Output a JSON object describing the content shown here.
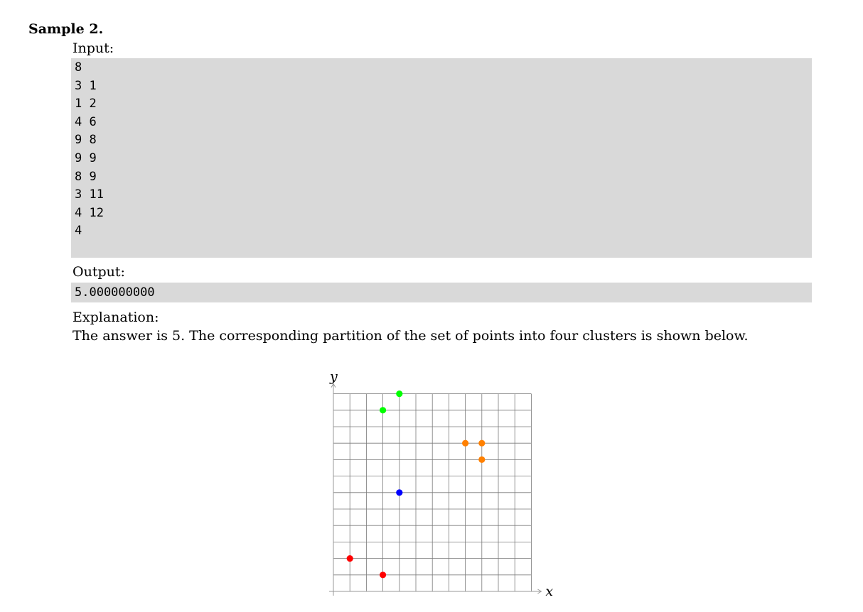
{
  "sample": {
    "heading": "Sample 2.",
    "input_label": "Input:",
    "input_lines": [
      "8",
      "3 1",
      "1 2",
      "4 6",
      "9 8",
      "9 9",
      "8 9",
      "3 11",
      "4 12",
      "4"
    ],
    "output_label": "Output:",
    "output_value": "5.000000000",
    "explanation_label": "Explanation:",
    "explanation_text": "The answer is 5. The corresponding partition of the set of points into four clusters is shown below."
  },
  "chart_data": {
    "type": "scatter",
    "title": "",
    "xlabel": "x",
    "ylabel": "y",
    "xlim": [
      0,
      12
    ],
    "ylim": [
      0,
      12
    ],
    "grid": true,
    "series": [
      {
        "color": "#ff0000",
        "points": [
          [
            1,
            2
          ],
          [
            3,
            1
          ]
        ]
      },
      {
        "color": "#0000ff",
        "points": [
          [
            4,
            6
          ]
        ]
      },
      {
        "color": "#ff8000",
        "points": [
          [
            8,
            9
          ],
          [
            9,
            9
          ],
          [
            9,
            8
          ]
        ]
      },
      {
        "color": "#00ff00",
        "points": [
          [
            3,
            11
          ],
          [
            4,
            12
          ]
        ]
      }
    ]
  }
}
